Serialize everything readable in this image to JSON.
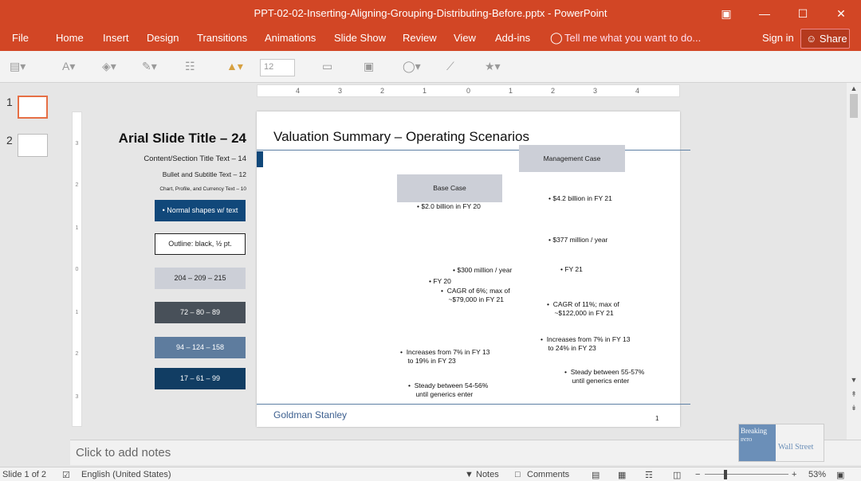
{
  "window": {
    "title": "PPT-02-02-Inserting-Aligning-Grouping-Distributing-Before.pptx - PowerPoint"
  },
  "menu": {
    "tabs": [
      "File",
      "Home",
      "Insert",
      "Design",
      "Transitions",
      "Animations",
      "Slide Show",
      "Review",
      "View",
      "Add-ins"
    ],
    "tell_me": "Tell me what you want to do...",
    "sign_in": "Sign in",
    "share": "Share"
  },
  "toolbar": {
    "font_size": "12"
  },
  "thumbnails": [
    {
      "num": "1"
    },
    {
      "num": "2"
    }
  ],
  "ruler": {
    "h_ticks": [
      "4",
      "3",
      "2",
      "1",
      "0",
      "1",
      "2",
      "3",
      "4"
    ],
    "v_ticks": [
      "3",
      "2",
      "1",
      "0",
      "1",
      "2",
      "3"
    ]
  },
  "left_panel": {
    "title": "Arial Slide Title – 24",
    "line1": "Content/Section Title Text – 14",
    "line2": "Bullet and Subtitle Text – 12",
    "line3": "Chart, Profile, and Currency Text – 10",
    "box1": "•  Normal shapes w/ text",
    "box2": "Outline: black, ½ pt.",
    "box3": "204 – 209 – 215",
    "box4": "72 – 80 – 89",
    "box5": "94 – 124 – 158",
    "box6": "17 – 61 – 99"
  },
  "colors": {
    "box1": "#11487a",
    "box3": "#cccfd7",
    "box4": "#485059",
    "box5": "#5e7c9e",
    "box6": "#113d63"
  },
  "slide": {
    "title": "Valuation Summary – Operating Scenarios",
    "base_case": "Base Case",
    "management_case": "Management Case",
    "b_base1": "•  $2.0 billion in FY 20",
    "b_mgmt1": "•  $4.2 billion in FY 21",
    "b_mgmt2": "•  $377 million / year",
    "b_base2": "•  $300 million / year",
    "b_mgmt3": "•  FY 21",
    "b_base3": "•  FY 20",
    "b_base4": "•  CAGR of 6%; max of\n    ~$79,000 in FY 21",
    "b_mgmt4": "•  CAGR of 11%; max of\n    ~$122,000 in FY 21",
    "b_mgmt5": "•  Increases from 7% in FY 13\n    to 24% in FY 23",
    "b_base5": "•  Increases from 7% in FY 13\n    to 19% in FY 23",
    "b_mgmt6": "•  Steady between 55-57%\n    until generics enter",
    "b_base6": "•  Steady between 54-56%\n    until generics enter",
    "footer": "Goldman Stanley",
    "page_num": "1"
  },
  "notes_placeholder": "Click to add notes",
  "status": {
    "slide_info": "Slide 1 of 2",
    "language": "English (United States)",
    "notes": "Notes",
    "comments": "Comments",
    "zoom": "53%"
  },
  "logo": {
    "text1": "Breaking",
    "text2": "INTO",
    "text3": "Wall Street"
  }
}
